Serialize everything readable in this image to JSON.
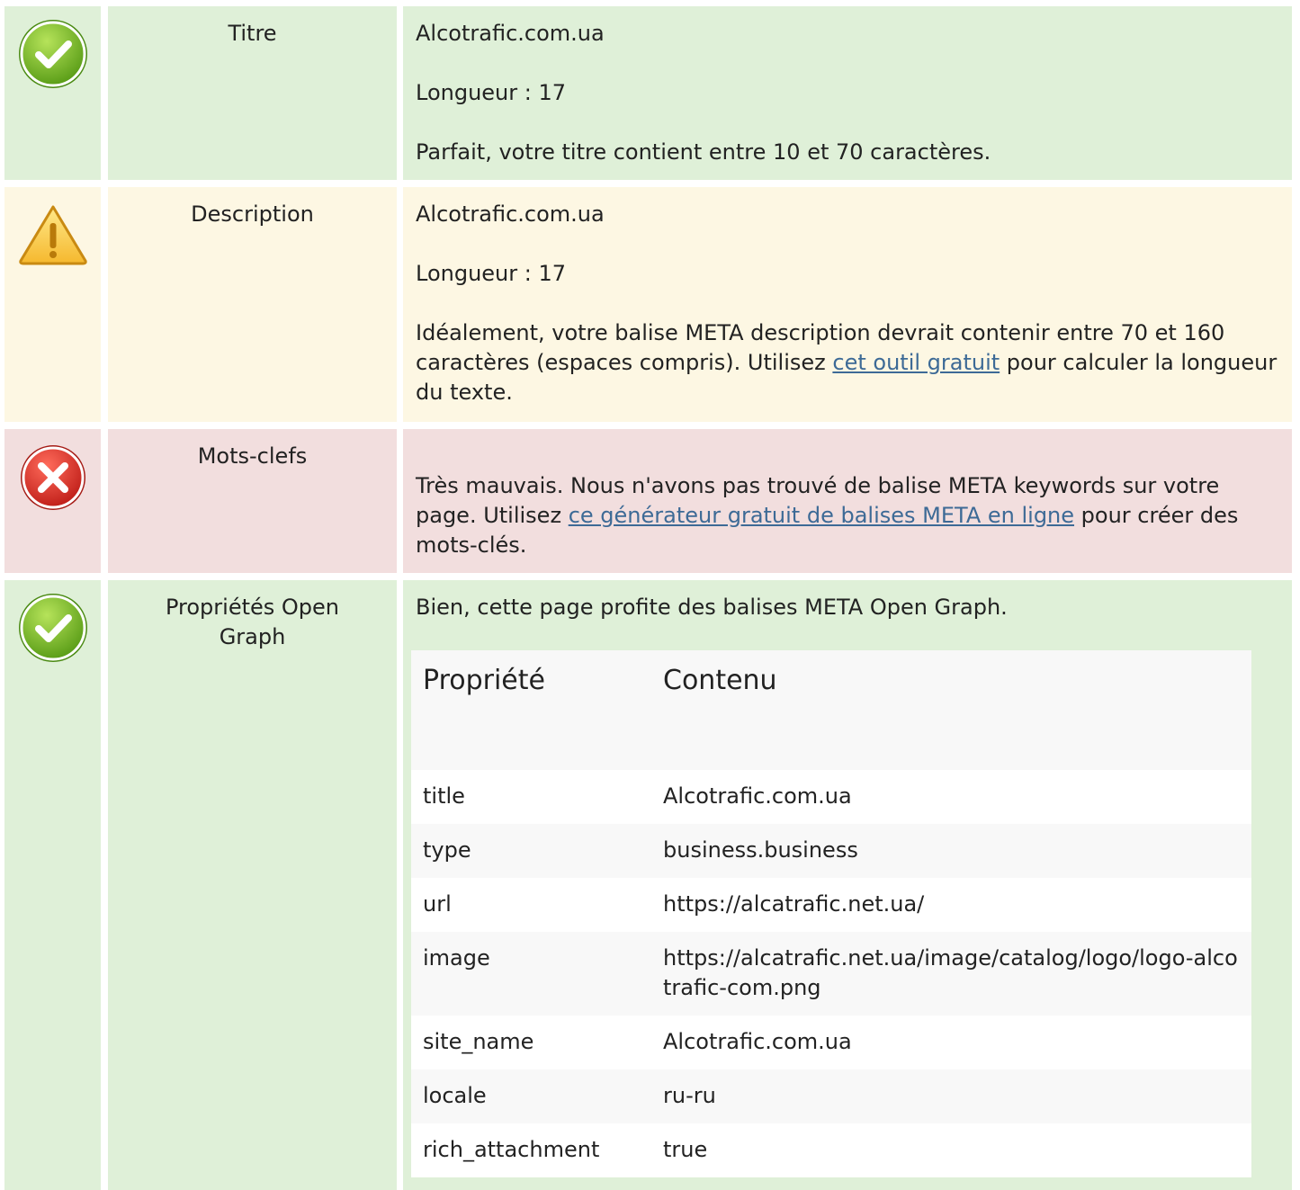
{
  "rows": {
    "title": {
      "status": "ok",
      "label": "Titre",
      "value": "Alcotrafic.com.ua",
      "length": "Longueur : 17",
      "message": "Parfait, votre titre contient entre 10 et 70 caractères."
    },
    "description": {
      "status": "warning",
      "label": "Description",
      "value": "Alcotrafic.com.ua",
      "length": "Longueur : 17",
      "message_before": "Idéalement, votre balise META description devrait contenir entre 70 et 160 caractères (espaces compris). Utilisez ",
      "link": "cet outil gratuit",
      "message_after": " pour calculer la longueur du texte."
    },
    "keywords": {
      "status": "error",
      "label": "Mots-clefs",
      "message_before": "Très mauvais. Nous n'avons pas trouvé de balise META keywords sur votre page. Utilisez ",
      "link": "ce générateur gratuit de balises META en ligne",
      "message_after": " pour créer des mots-clés."
    },
    "opengraph": {
      "status": "ok",
      "label": "Propriétés Open Graph",
      "message": "Bien, cette page profite des balises META Open Graph.",
      "table": {
        "headers": [
          "Propriété",
          "Contenu"
        ],
        "rows": [
          {
            "property": "title",
            "content": "Alcotrafic.com.ua"
          },
          {
            "property": "type",
            "content": "business.business"
          },
          {
            "property": "url",
            "content": "https://alcatrafic.net.ua/"
          },
          {
            "property": "image",
            "content": "https://alcatrafic.net.ua/image/catalog/logo/logo-alcotrafic-com.png"
          },
          {
            "property": "site_name",
            "content": "Alcotrafic.com.ua"
          },
          {
            "property": "locale",
            "content": "ru-ru"
          },
          {
            "property": "rich_attachment",
            "content": "true"
          }
        ]
      }
    }
  },
  "colors": {
    "ok_bg": "#dff0d8",
    "warning_bg": "#fdf7e3",
    "error_bg": "#f2dede",
    "link": "#3d6a96"
  },
  "icons": {
    "ok": "check-circle-icon",
    "warning": "warning-triangle-icon",
    "error": "x-circle-icon"
  }
}
